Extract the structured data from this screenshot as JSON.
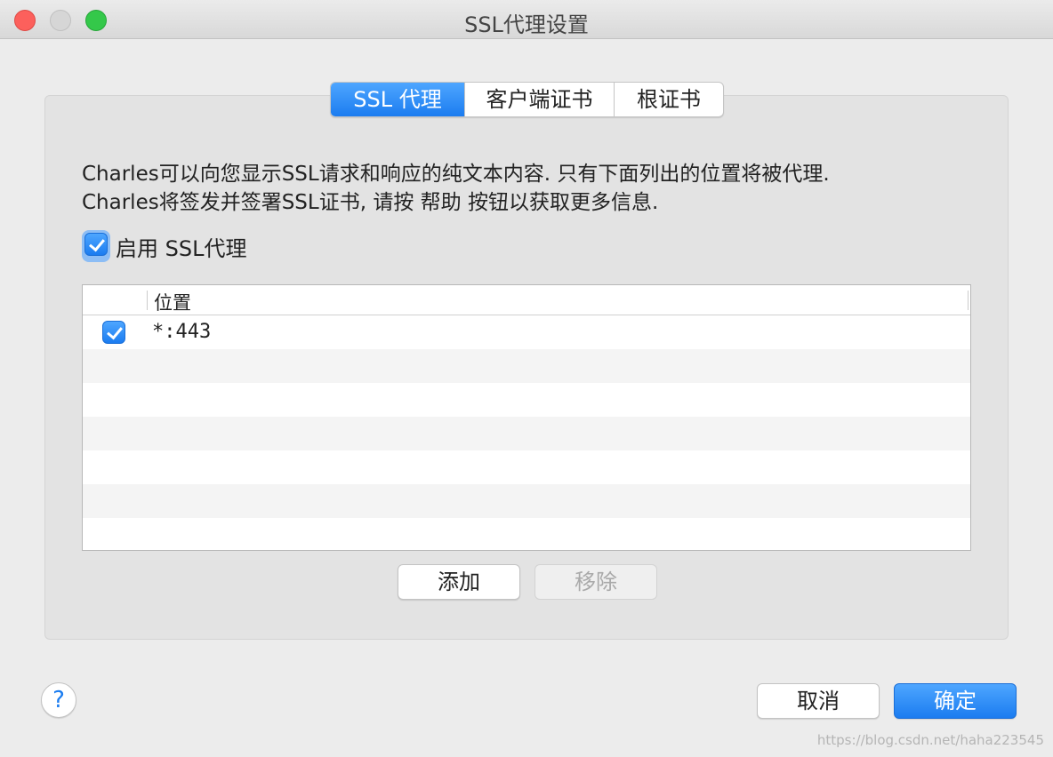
{
  "window": {
    "title": "SSL代理设置"
  },
  "tabs": [
    {
      "label": "SSL 代理",
      "active": true
    },
    {
      "label": "客户端证书",
      "active": false
    },
    {
      "label": "根证书",
      "active": false
    }
  ],
  "description": {
    "line1": "Charles可以向您显示SSL请求和响应的纯文本内容. 只有下面列出的位置将被代理.",
    "line2": "Charles将签发并签署SSL证书, 请按 帮助 按钮以获取更多信息."
  },
  "enable_ssl": {
    "label": "启用 SSL代理",
    "checked": true
  },
  "locations_table": {
    "header": "位置",
    "rows": [
      {
        "enabled": true,
        "location": "*:443"
      }
    ]
  },
  "buttons": {
    "add": "添加",
    "remove": "移除",
    "cancel": "取消",
    "ok": "确定",
    "help": "?"
  },
  "watermark": "https://blog.csdn.net/haha223545",
  "colors": {
    "accent": "#1b7cf0",
    "close": "#fc605c",
    "maximize": "#34c84a"
  }
}
